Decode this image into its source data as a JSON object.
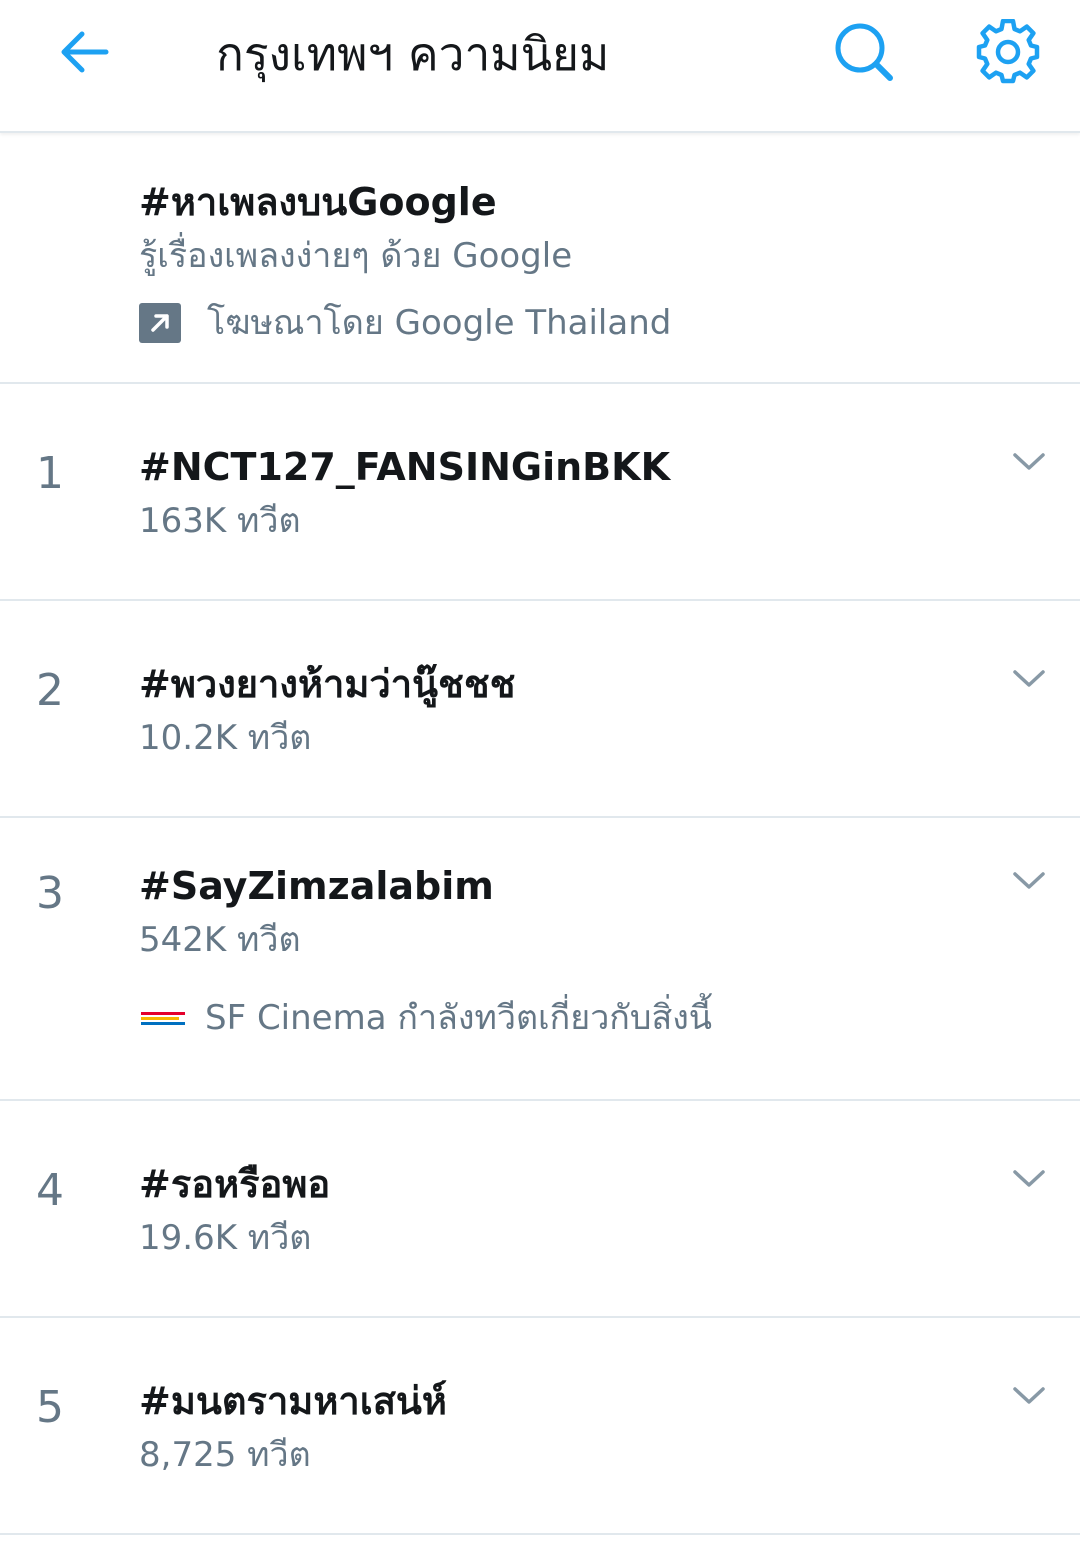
{
  "header": {
    "title": "กรุงเทพฯ ความนิยม",
    "back_icon": "arrow-left-icon",
    "search_icon": "search-icon",
    "settings_icon": "gear-icon"
  },
  "promoted": {
    "hashtag": "#หาเพลงบนGoogle",
    "description": "รู้เรื่องเพลงง่ายๆ ด้วย Google",
    "ad_label": "โฆษณาโดย Google Thailand",
    "ad_icon": "promoted-arrow-icon"
  },
  "trends": [
    {
      "rank": "1",
      "hashtag": "#NCT127_FANSINGinBKK",
      "count": "163K ทวีต"
    },
    {
      "rank": "2",
      "hashtag": "#พวงยางห้ามว่านู๊ชชช",
      "count": "10.2K ทวีต"
    },
    {
      "rank": "3",
      "hashtag": "#SayZimzalabim",
      "count": "542K ทวีต",
      "promoter": "SF Cinema กำลังทวีตเกี่ยวกับสิ่งนี้"
    },
    {
      "rank": "4",
      "hashtag": "#รอหรือพอ",
      "count": "19.6K ทวีต"
    },
    {
      "rank": "5",
      "hashtag": "#มนตรามหาเสน่ห์",
      "count": "8,725 ทวีต"
    }
  ],
  "colors": {
    "accent": "#1da1f2",
    "secondary_text": "#657786",
    "primary_text": "#14171a",
    "divider": "#e1e8ed"
  }
}
